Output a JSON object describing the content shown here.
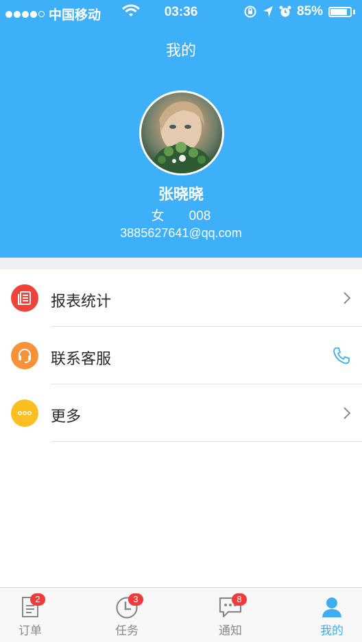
{
  "status_bar": {
    "carrier": "中国移动",
    "time": "03:36",
    "battery": "85%",
    "battery_level": 0.85
  },
  "header": {
    "title": "我的"
  },
  "profile": {
    "name": "张晓晓",
    "gender": "女",
    "id": "008",
    "email": "3885627641@qq.com"
  },
  "menu": [
    {
      "label": "报表统计",
      "icon": "report-icon",
      "color": "#ef4238",
      "accessory": "chevron-right-icon"
    },
    {
      "label": "联系客服",
      "icon": "headset-icon",
      "color": "#f7913a",
      "accessory": "phone-icon"
    },
    {
      "label": "更多",
      "icon": "more-icon",
      "color": "#fbbf22",
      "accessory": "chevron-right-icon"
    }
  ],
  "tabbar": [
    {
      "label": "订单",
      "icon": "order-icon",
      "badge": "2"
    },
    {
      "label": "任务",
      "icon": "clock-icon",
      "badge": "3"
    },
    {
      "label": "通知",
      "icon": "message-icon",
      "badge": "8"
    },
    {
      "label": "我的",
      "icon": "user-icon",
      "active": true
    }
  ],
  "colors": {
    "header_bg": "#3eb0fa",
    "active_tab": "#3eaef4",
    "badge": "#f13a3a"
  }
}
